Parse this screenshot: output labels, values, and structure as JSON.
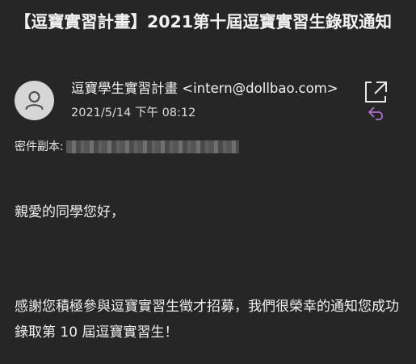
{
  "email": {
    "subject": "【逗寶實習計畫】2021第十屆逗寶實習生錄取通知",
    "sender": "逗寶學生實習計畫 <intern@dollbao.com>",
    "date": "2021/5/14 下午 08:12",
    "cc_label": "密件副本:",
    "greeting": "親愛的同學您好，",
    "body": "感謝您積極參與逗寶實習生徵才招募，我們很榮幸的通知您成功錄取第 10 屆逗寶實習生！"
  },
  "icons": {
    "avatar": "person-icon",
    "popout": "open-in-new-window-icon",
    "reply": "reply-icon"
  },
  "colors": {
    "background": "#262626",
    "text": "#f2f2f2",
    "accent": "#b46fd1"
  }
}
